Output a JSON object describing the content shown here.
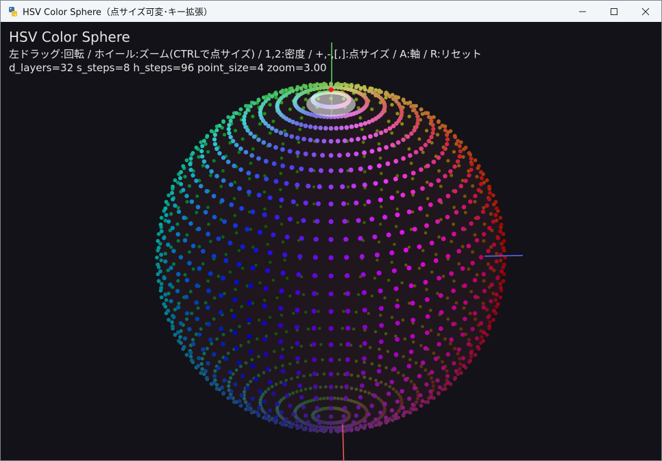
{
  "window": {
    "title": "HSV Color Sphere（点サイズ可変･キー拡張）",
    "icon": "python-icon",
    "controls": {
      "minimize": "minimize-icon",
      "maximize": "maximize-icon",
      "close": "close-icon"
    }
  },
  "hud": {
    "title": "HSV Color Sphere",
    "help": "左ドラッグ:回転 / ホイール:ズーム(CTRLで点サイズ) / 1,2:密度 / +,-,[,]:点サイズ / A:軸 / R:リセット",
    "status": "d_layers=32  s_steps=8  h_steps=96  point_size=4  zoom=3.00"
  },
  "scene": {
    "background": "#131218",
    "axis_colors": {
      "x": "#5b6cff",
      "y": "#5de35d",
      "z": "#ff5b5b"
    },
    "d_layers": 32,
    "s_steps": 8,
    "h_steps": 96,
    "point_size": 4,
    "zoom": 3.0
  }
}
